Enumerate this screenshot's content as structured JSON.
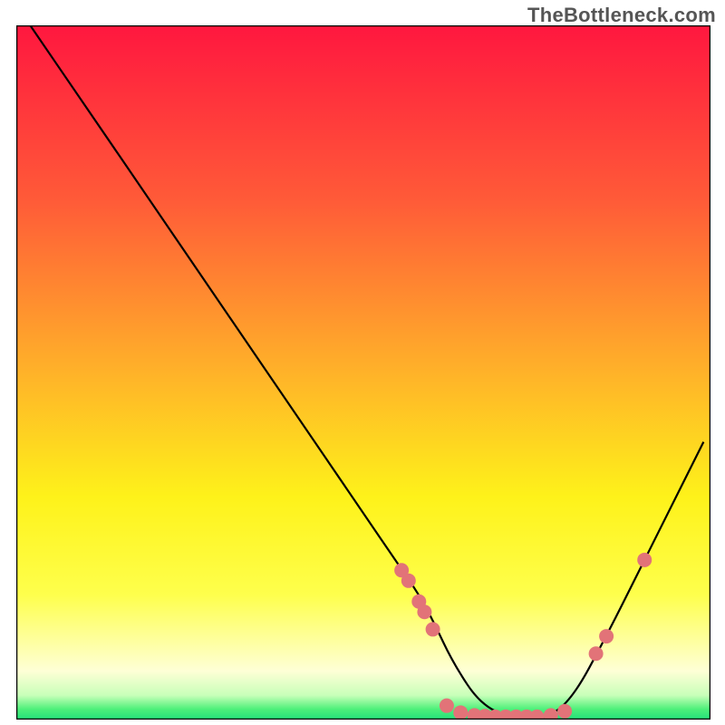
{
  "watermark": "TheBottleneck.com",
  "chart_data": {
    "type": "line",
    "title": "",
    "xlabel": "",
    "ylabel": "",
    "xlim": [
      0,
      100
    ],
    "ylim": [
      0,
      100
    ],
    "background_gradient": {
      "stops": [
        {
          "pos": 0.0,
          "color": "#ff173f"
        },
        {
          "pos": 0.25,
          "color": "#ff5a38"
        },
        {
          "pos": 0.5,
          "color": "#ffb229"
        },
        {
          "pos": 0.68,
          "color": "#fef21a"
        },
        {
          "pos": 0.82,
          "color": "#feff4c"
        },
        {
          "pos": 0.89,
          "color": "#feffa3"
        },
        {
          "pos": 0.93,
          "color": "#feffd6"
        },
        {
          "pos": 0.965,
          "color": "#c8ffb9"
        },
        {
          "pos": 0.985,
          "color": "#4ef07a"
        },
        {
          "pos": 1.0,
          "color": "#22e07a"
        }
      ]
    },
    "series": [
      {
        "name": "curve",
        "x": [
          2,
          10,
          20,
          30,
          40,
          50,
          55,
          58,
          60,
          63,
          67,
          72,
          76,
          80,
          85,
          90,
          95,
          99
        ],
        "y": [
          100,
          88.3,
          73.7,
          59.0,
          44.4,
          29.7,
          22.4,
          18.0,
          14.3,
          8.0,
          2.0,
          0.0,
          0.0,
          2.8,
          12.0,
          22.0,
          32.0,
          40.0
        ],
        "color": "#000000",
        "stroke_width": 2.2
      }
    ],
    "annotations": {
      "dots": [
        {
          "x": 55.5,
          "y": 21.5
        },
        {
          "x": 56.5,
          "y": 20.0
        },
        {
          "x": 58.0,
          "y": 17.0
        },
        {
          "x": 58.8,
          "y": 15.5
        },
        {
          "x": 60.0,
          "y": 13.0
        },
        {
          "x": 62.0,
          "y": 2.0
        },
        {
          "x": 64.0,
          "y": 1.0
        },
        {
          "x": 66.0,
          "y": 0.6
        },
        {
          "x": 67.5,
          "y": 0.5
        },
        {
          "x": 69.0,
          "y": 0.4
        },
        {
          "x": 70.5,
          "y": 0.4
        },
        {
          "x": 72.0,
          "y": 0.4
        },
        {
          "x": 73.5,
          "y": 0.4
        },
        {
          "x": 75.0,
          "y": 0.4
        },
        {
          "x": 77.0,
          "y": 0.6
        },
        {
          "x": 79.0,
          "y": 1.2
        },
        {
          "x": 83.5,
          "y": 9.5
        },
        {
          "x": 85.0,
          "y": 12.0
        },
        {
          "x": 90.5,
          "y": 23.0
        }
      ],
      "dot_color": "#e27378",
      "dot_radius": 8
    }
  }
}
